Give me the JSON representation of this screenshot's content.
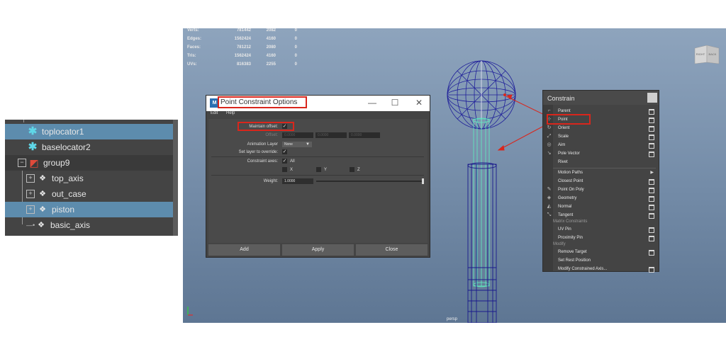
{
  "colors": {
    "selection": "#5d8cad",
    "locator": "#5fd7e8",
    "annotation_red": "#d9261c",
    "panel": "#444444",
    "wire_blue": "#1f1f9a",
    "wire_green": "#5ff0c0"
  },
  "outliner": {
    "items": [
      {
        "label": "toplocator1",
        "icon": "locator-icon",
        "selected": true
      },
      {
        "label": "baselocator2",
        "icon": "locator-icon",
        "selected": false
      },
      {
        "label": "group9",
        "icon": "group-icon",
        "selected": false
      },
      {
        "label": "top_axis",
        "icon": "transform-icon",
        "selected": false
      },
      {
        "label": "out_case",
        "icon": "transform-icon",
        "selected": false
      },
      {
        "label": "piston",
        "icon": "transform-icon",
        "selected": true
      },
      {
        "label": "basic_axis",
        "icon": "transform-icon",
        "selected": false
      }
    ]
  },
  "hud": {
    "rows": [
      {
        "k": "Verts:",
        "a": "781442",
        "b": "2082",
        "c": "0"
      },
      {
        "k": "Edges:",
        "a": "1562424",
        "b": "4160",
        "c": "0"
      },
      {
        "k": "Faces:",
        "a": "781212",
        "b": "2080",
        "c": "0"
      },
      {
        "k": "Tris:",
        "a": "1562424",
        "b": "4160",
        "c": "0"
      },
      {
        "k": "UVs:",
        "a": "816383",
        "b": "2255",
        "c": "0"
      }
    ]
  },
  "viewcube": {
    "left": "RIGHT",
    "right": "BACK"
  },
  "viewport": {
    "camera": "persp"
  },
  "dialog": {
    "app_icon": "M",
    "title": "Point Constraint Options",
    "menu": [
      "Edit",
      "Help"
    ],
    "maintain_offset_label": "Maintain offset:",
    "maintain_offset_checked": "✓",
    "offset_label": "Offset:",
    "offset_values": [
      "0.0000",
      "0.0000",
      "0.0000"
    ],
    "animation_layer_label": "Animation Layer",
    "animation_layer_value": "None",
    "set_layer_label": "Set layer to override:",
    "set_layer_checked": "✓",
    "constraint_axes_label": "Constraint axes:",
    "axes_all_label": "All",
    "axes_all_checked": "✓",
    "axes": [
      "X",
      "Y",
      "Z"
    ],
    "weight_label": "Weight:",
    "weight_value": "1.0000",
    "buttons": {
      "add": "Add",
      "apply": "Apply",
      "close": "Close"
    }
  },
  "constrain_menu": {
    "title": "Constrain",
    "items": [
      {
        "label": "Parent",
        "option": true
      },
      {
        "label": "Point",
        "option": true
      },
      {
        "label": "Orient",
        "option": true
      },
      {
        "label": "Scale",
        "option": true
      },
      {
        "label": "Aim",
        "option": true
      },
      {
        "label": "Pole Vector",
        "option": true
      },
      {
        "label": "Rivet",
        "option": false
      },
      {
        "label": "Motion Paths",
        "submenu": true
      },
      {
        "label": "Closest Point",
        "option": true
      },
      {
        "label": "Point On Poly",
        "option": true
      },
      {
        "label": "Geometry",
        "option": true
      },
      {
        "label": "Normal",
        "option": true
      },
      {
        "label": "Tangent",
        "option": true
      },
      {
        "label": "UV Pin",
        "option": true
      },
      {
        "label": "Proximity Pin",
        "option": true
      },
      {
        "label": "Remove Target",
        "option": true
      },
      {
        "label": "Set Rest Position",
        "option": false
      },
      {
        "label": "Modify Constrained Axis...",
        "option": true
      }
    ],
    "sections": [
      "Matrix Constraints",
      "Modify"
    ]
  }
}
